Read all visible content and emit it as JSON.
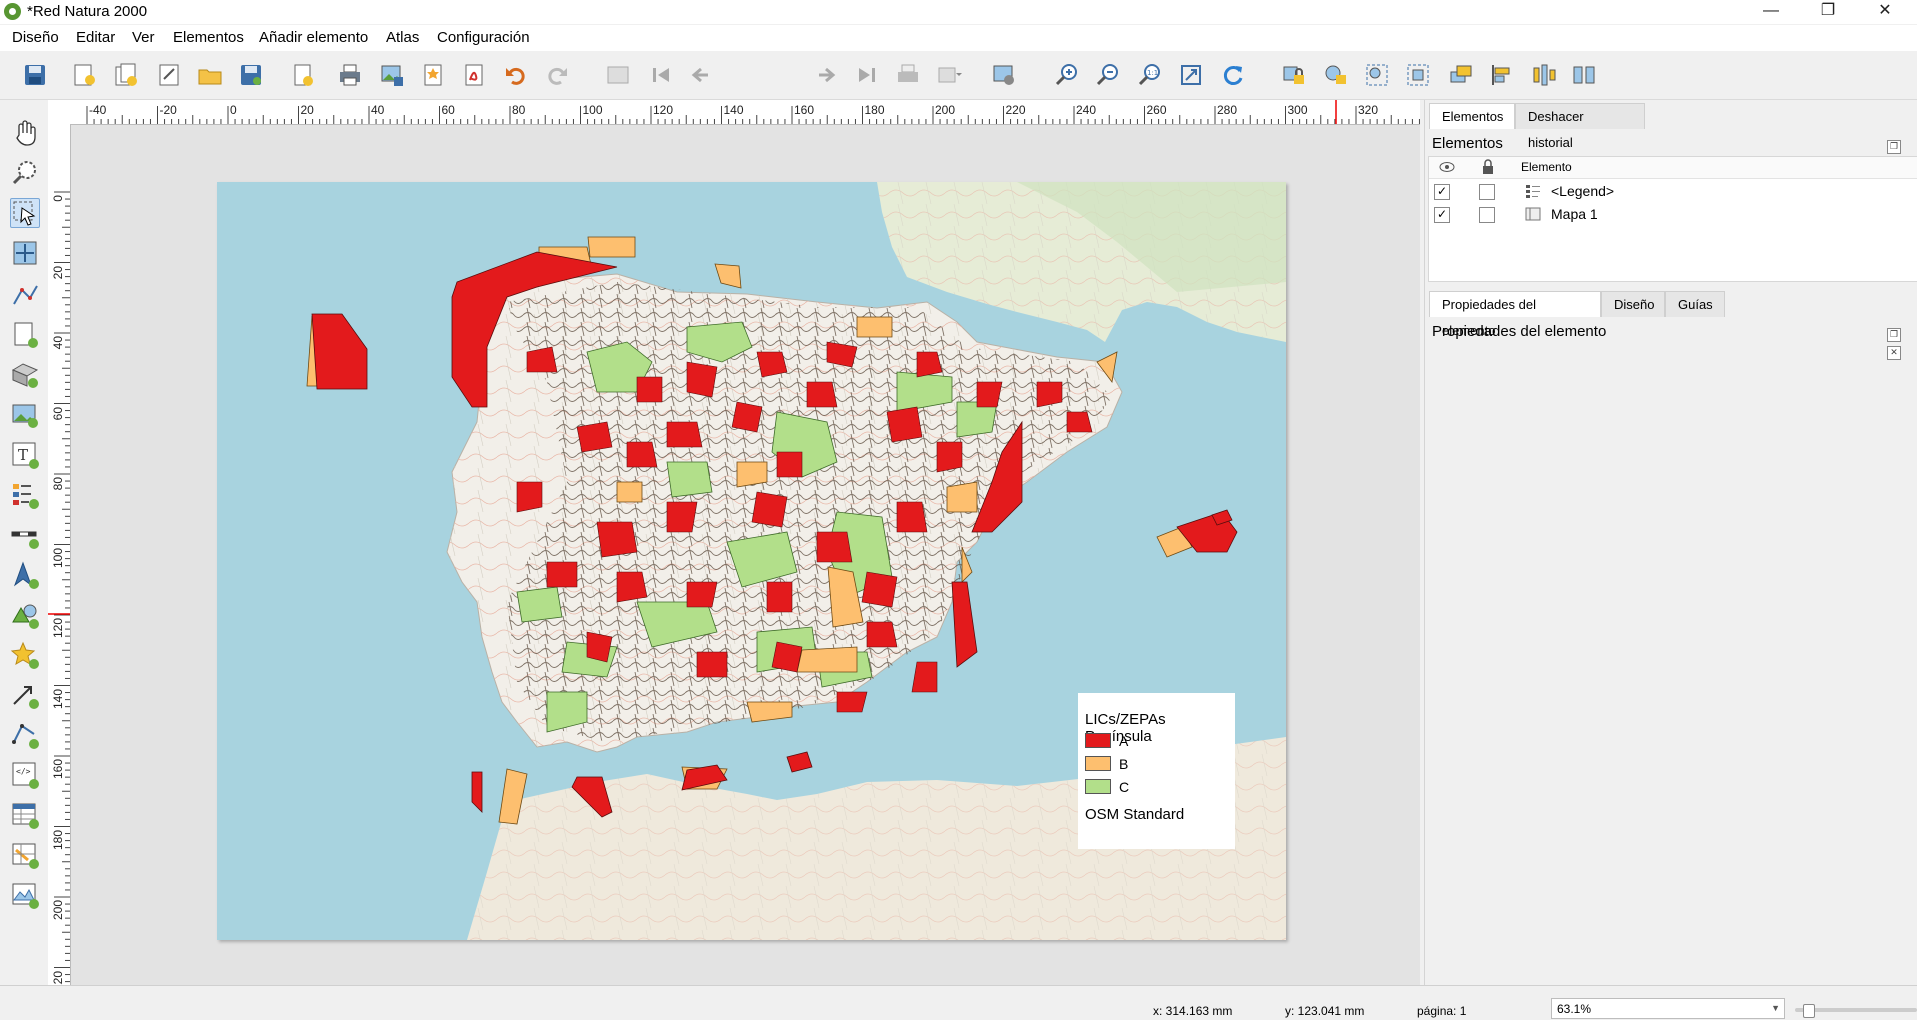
{
  "window": {
    "title": "*Red Natura 2000",
    "minimize": "—",
    "maximize": "❐",
    "close": "✕"
  },
  "menu": [
    "Diseño",
    "Editar",
    "Ver",
    "Elementos",
    "Añadir elemento",
    "Atlas",
    "Configuración"
  ],
  "toolbar": {
    "page_value": "1",
    "icons": [
      "save-icon",
      "new-layout-icon",
      "duplicate-layout-icon",
      "layout-manager-icon",
      "open-folder-icon",
      "save-template-icon",
      "add-pages-icon",
      "print-icon",
      "export-image-icon",
      "export-svg-icon",
      "export-pdf-icon",
      "undo-icon",
      "redo-icon",
      "atlas-preview-icon",
      "first-feature-icon",
      "prev-feature-icon",
      "next-feature-icon",
      "last-feature-icon",
      "atlas-print-icon",
      "atlas-export-icon",
      "atlas-settings-icon",
      "zoom-in-icon",
      "zoom-out-icon",
      "zoom-100-icon",
      "zoom-full-icon",
      "refresh-icon",
      "lock-items-icon",
      "unlock-items-icon",
      "group-icon",
      "ungroup-icon",
      "raise-icon",
      "align-left-icon",
      "distribute-icon",
      "resize-icon"
    ]
  },
  "left_tools": [
    "pan-tool-icon",
    "zoom-tool-icon",
    "select-move-item-icon",
    "move-content-icon",
    "edit-nodes-icon",
    "add-map-icon",
    "add-3d-map-icon",
    "add-picture-icon",
    "add-label-icon",
    "add-legend-icon",
    "add-scalebar-icon",
    "add-north-arrow-icon",
    "add-shape-icon",
    "add-marker-icon",
    "add-arrow-icon",
    "add-node-item-icon",
    "add-html-icon",
    "add-attribute-table-icon",
    "add-fixed-table-icon",
    "add-elevation-profile-icon"
  ],
  "ruler": {
    "h_ticks": [
      "-40",
      "-20",
      "0",
      "20",
      "40",
      "60",
      "80",
      "100",
      "120",
      "140",
      "160",
      "180",
      "200",
      "220",
      "240",
      "260",
      "280",
      "300",
      "320"
    ],
    "v_ticks": [
      "0",
      "20",
      "40",
      "60",
      "80",
      "100",
      "120",
      "140",
      "160",
      "180",
      "200",
      "220"
    ]
  },
  "legend": {
    "title": "LICs/ZEPAs Península",
    "items": [
      {
        "label": "A",
        "color": "#e31a1c"
      },
      {
        "label": "B",
        "color": "#fdbf6f"
      },
      {
        "label": "C",
        "color": "#b2df8a"
      }
    ],
    "basemap": "OSM Standard"
  },
  "right_panel": {
    "tabs_top": [
      "Elementos",
      "Deshacer historial"
    ],
    "elements_title": "Elementos",
    "col_header": "Elemento",
    "rows": [
      {
        "label": "<Legend>",
        "visible": "✓"
      },
      {
        "label": "Mapa 1",
        "visible": "✓"
      }
    ],
    "tabs_bottom": [
      "Propiedades del elemento",
      "Diseño",
      "Guías"
    ],
    "properties_title": "Propiedades del elemento"
  },
  "status": {
    "x": "x: 314.163 mm",
    "y": "y: 123.041 mm",
    "page": "página: 1",
    "zoom": "63.1%"
  },
  "colors": {
    "sea": "#a8d3df",
    "land": "#f2efe9",
    "accent": "#cfe3f7"
  }
}
